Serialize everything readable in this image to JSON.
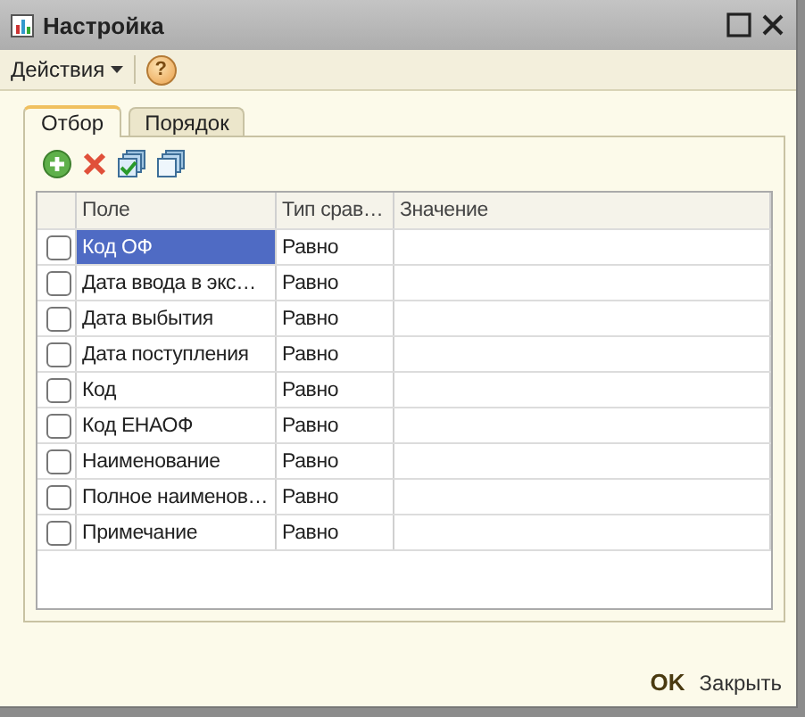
{
  "window": {
    "title": "Настройка"
  },
  "toolbar": {
    "menu": "Действия",
    "help": "?"
  },
  "tabs": [
    {
      "label": "Отбор",
      "selected": true
    },
    {
      "label": "Порядок",
      "selected": false
    }
  ],
  "table": {
    "columns": [
      "Поле",
      "Тип срав…",
      "Значение"
    ],
    "rows": [
      {
        "checked": false,
        "selected": true,
        "field": "Код ОФ",
        "type": "Равно"
      },
      {
        "checked": false,
        "selected": false,
        "field": "Дата ввода в экс…",
        "type": "Равно"
      },
      {
        "checked": false,
        "selected": false,
        "field": "Дата выбытия",
        "type": "Равно"
      },
      {
        "checked": false,
        "selected": false,
        "field": "Дата поступления",
        "type": "Равно"
      },
      {
        "checked": false,
        "selected": false,
        "field": "Код",
        "type": "Равно"
      },
      {
        "checked": false,
        "selected": false,
        "field": "Код ЕНАОФ",
        "type": "Равно"
      },
      {
        "checked": false,
        "selected": false,
        "field": "Наименование",
        "type": "Равно"
      },
      {
        "checked": false,
        "selected": false,
        "field": "Полное наименов…",
        "type": "Равно"
      },
      {
        "checked": false,
        "selected": false,
        "field": "Примечание",
        "type": "Равно"
      }
    ]
  },
  "buttons": {
    "ok": "OK",
    "close": "Закрыть"
  }
}
